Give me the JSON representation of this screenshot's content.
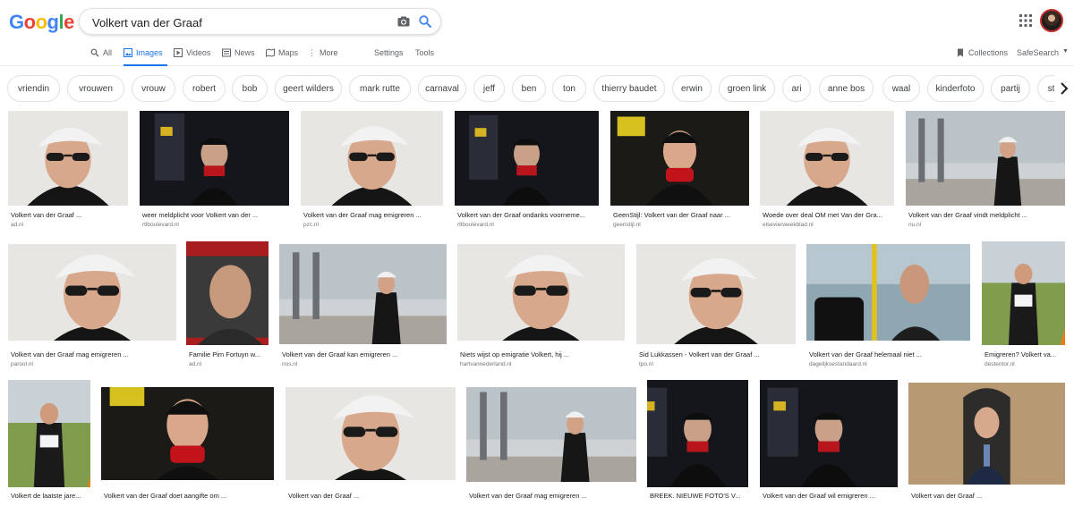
{
  "search": {
    "query": "Volkert van der Graaf"
  },
  "logo": {
    "letters": [
      "G",
      "o",
      "o",
      "g",
      "l",
      "e"
    ],
    "colors": [
      "#4285f4",
      "#ea4335",
      "#fbbc05",
      "#4285f4",
      "#34a853",
      "#ea4335"
    ]
  },
  "tabs": {
    "all": "All",
    "images": "Images",
    "videos": "Videos",
    "news": "News",
    "maps": "Maps",
    "more": "More",
    "settings": "Settings",
    "tools": "Tools",
    "collections": "Collections",
    "safesearch": "SafeSearch"
  },
  "chips": [
    "vriendin",
    "vrouwen",
    "vrouw",
    "robert",
    "bob",
    "geert wilders",
    "mark rutte",
    "carnaval",
    "jeff",
    "ben",
    "ton",
    "thierry baudet",
    "erwin",
    "groen link",
    "ari",
    "anne bos",
    "waal",
    "kinderfoto",
    "partij",
    "staat"
  ],
  "results": [
    {
      "title": "Volkert van der Graaf ...",
      "source": "ad.nl"
    },
    {
      "title": "weer meldplicht voor Volkert van der ...",
      "source": "rtlboulevard.nl"
    },
    {
      "title": "Volkert van der Graaf mag emigreren ...",
      "source": "pzc.nl"
    },
    {
      "title": "Volkert van der Graaf ondanks voorneme...",
      "source": "rtlboulevard.nl"
    },
    {
      "title": "GeenStijl: Volkert van der Graaf naar ...",
      "source": "geenstijl.nl"
    },
    {
      "title": "Woede over deal OM met Van der Gra...",
      "source": "elsevierweekblad.nl"
    },
    {
      "title": "Volkert van der Graaf vindt meldplicht ...",
      "source": "nu.nl"
    },
    {
      "title": "Volkert van der Graaf mag emigreren ...",
      "source": "parool.nl"
    },
    {
      "title": "Familie Pim Fortuyn w...",
      "source": "ad.nl"
    },
    {
      "title": "Volkert van der Graaf kan emigreren ...",
      "source": "nos.nl"
    },
    {
      "title": "Niets wijst op emigratie Volkert, hij ...",
      "source": "hartvannederland.nl"
    },
    {
      "title": "Sid Lukkassen - Volkert van der Graaf ...",
      "source": "tpo.nl"
    },
    {
      "title": "Volkert van der Graaf helemaal niet ...",
      "source": "dagelijksestandaard.nl"
    },
    {
      "title": "Emigreren? Volkert va...",
      "source": "destentor.nl"
    },
    {
      "title": "Volkert de laatste jare...",
      "source": ""
    },
    {
      "title": "Volkert van der Graaf doet aangifte om ...",
      "source": ""
    },
    {
      "title": "Volkert van der Graaf ...",
      "source": ""
    },
    {
      "title": "Volkert van der Graaf mag emigreren ...",
      "source": ""
    },
    {
      "title": "BREEK. NIEUWE FOTO'S V...",
      "source": ""
    },
    {
      "title": "Volkert van der Graaf wil emigreren ...",
      "source": ""
    },
    {
      "title": "Volkert van der Graaf ...",
      "source": ""
    }
  ]
}
